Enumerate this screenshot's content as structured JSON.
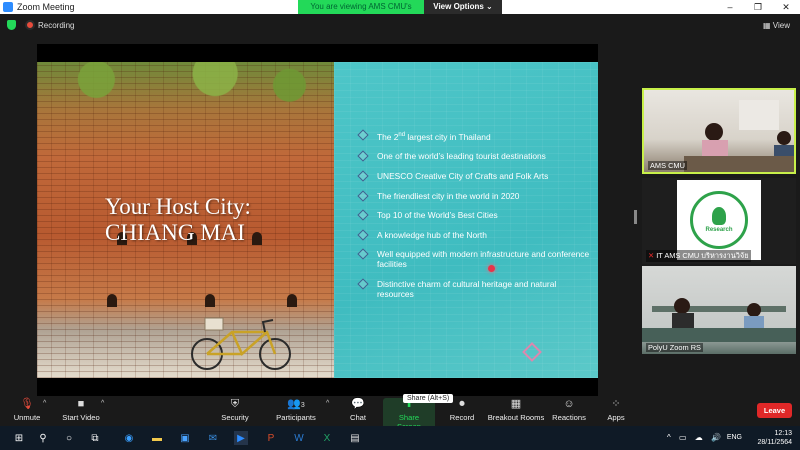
{
  "window": {
    "title": "Zoom Meeting",
    "controls": [
      "–",
      "❐",
      "✕"
    ]
  },
  "share_banner": {
    "text": "You are viewing AMS CMU's screen",
    "view_options": "View Options ⌄"
  },
  "top": {
    "recording": "Recording",
    "view": "View"
  },
  "slide": {
    "title_line1": "Your Host City:",
    "title_line2": "CHIANG MAI",
    "bullets": [
      "The 2nd largest city in Thailand",
      "One of the world’s leading tourist destinations",
      "UNESCO Creative City of Crafts and Folk Arts",
      "The friendliest city in the world in 2020",
      "Top 10 of the World’s Best Cities",
      "A knowledge hub of the North",
      "Well equipped with modern infrastructure and conference facilities",
      "Distinctive charm of cultural heritage and natural resources"
    ]
  },
  "participants": [
    {
      "label": "AMS CMU"
    },
    {
      "label": "IT AMS CMU บริหารงานวิจัย",
      "logo_text": "Research"
    },
    {
      "label": "PolyU Zoom RS"
    }
  ],
  "toolbar": {
    "unmute": "Unmute",
    "start_video": "Start Video",
    "security": "Security",
    "participants": "Participants",
    "participant_count": "3",
    "chat": "Chat",
    "share_screen": "Share Screen",
    "share_tooltip": "Share (Alt+S)",
    "record": "Record",
    "breakout": "Breakout Rooms",
    "reactions": "Reactions",
    "apps": "Apps",
    "leave": "Leave"
  },
  "taskbar": {
    "lang": "ENG",
    "time": "12:13",
    "date": "28/11/2564"
  },
  "colors": {
    "zoom_blue": "#2d8cff",
    "share_green": "#23d959",
    "leave_red": "#e02828",
    "slide_teal": "#3fbcc0"
  }
}
